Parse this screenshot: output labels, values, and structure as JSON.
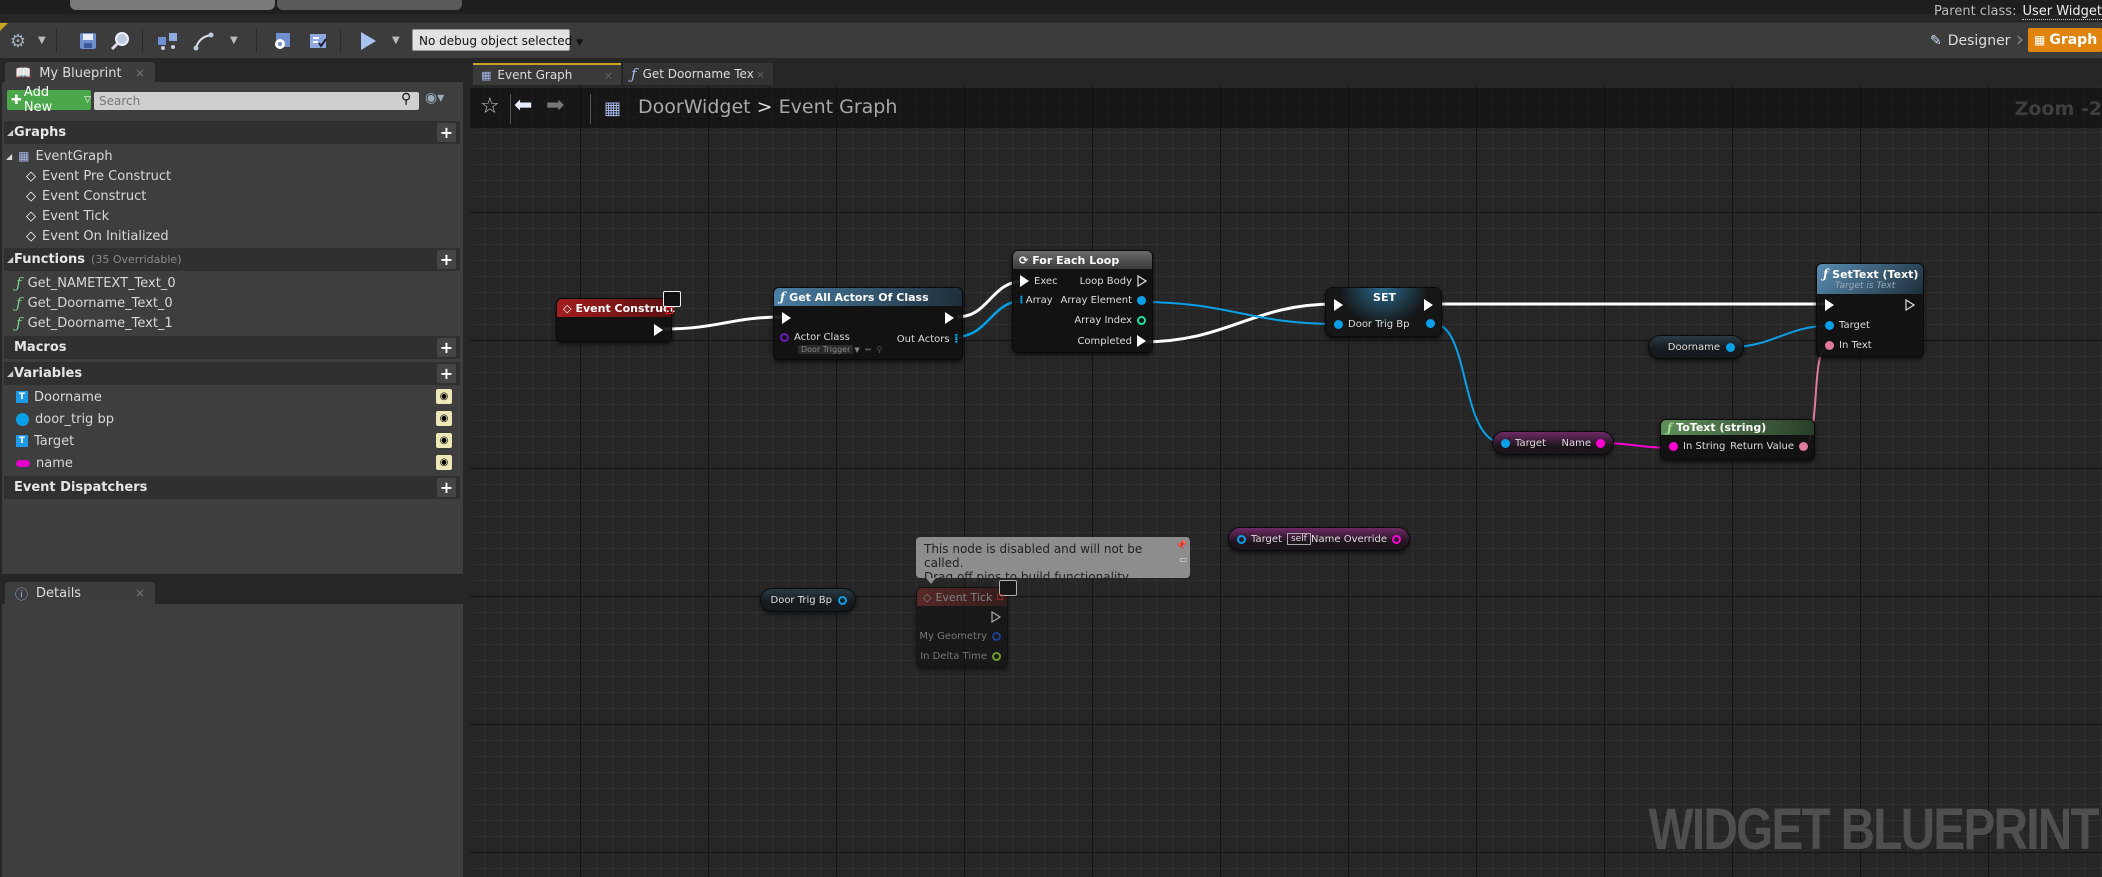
{
  "window": {
    "parent_class_label": "Parent class:",
    "parent_class_value": "User Widget"
  },
  "toolbar": {
    "compile_icon": "compile-gear-icon",
    "save_icon": "save-icon",
    "browse_icon": "find-in-browser-icon",
    "class_settings_icon": "class-settings-icon",
    "class_defaults_icon": "class-defaults-icon",
    "play_icon": "play-icon",
    "debug_object": "No debug object selected",
    "designer_label": "Designer",
    "graph_label": "Graph"
  },
  "my_blueprint": {
    "tab_label": "My Blueprint",
    "add_new_label": "Add New",
    "search_placeholder": "Search",
    "sections": {
      "graphs": {
        "label": "Graphs",
        "items": [
          {
            "label": "EventGraph"
          },
          {
            "label": "Event Pre Construct"
          },
          {
            "label": "Event Construct"
          },
          {
            "label": "Event Tick"
          },
          {
            "label": "Event On Initialized"
          }
        ]
      },
      "functions": {
        "label": "Functions",
        "hint": "(35 Overridable)",
        "items": [
          {
            "label": "Get_NAMETEXT_Text_0"
          },
          {
            "label": "Get_Doorname_Text_0"
          },
          {
            "label": "Get_Doorname_Text_1"
          }
        ]
      },
      "macros": {
        "label": "Macros"
      },
      "variables": {
        "label": "Variables",
        "items": [
          {
            "label": "Doorname",
            "type": "text-widget-ref",
            "color": "#1e9be8"
          },
          {
            "label": "door_trig bp",
            "type": "object-ref",
            "color": "#0aa0e8"
          },
          {
            "label": "Target",
            "type": "text-widget-ref",
            "color": "#1e9be8"
          },
          {
            "label": "name",
            "type": "string",
            "color": "#e000c8"
          }
        ]
      },
      "event_dispatchers": {
        "label": "Event Dispatchers"
      }
    }
  },
  "details": {
    "tab_label": "Details"
  },
  "graph_tabs": [
    {
      "label": "Event Graph",
      "active": true
    },
    {
      "label": "Get Doorname Tex",
      "active": false
    }
  ],
  "breadcrumb": {
    "root": "DoorWidget",
    "separator": ">",
    "current": "Event Graph"
  },
  "zoom_label": "Zoom -2",
  "watermark": "WIDGET BLUEPRINT",
  "nodes": {
    "event_construct": {
      "title": "Event Construct"
    },
    "get_all_actors": {
      "title": "Get All Actors Of Class",
      "actor_class_label": "Actor Class",
      "actor_class_value": "Door Trigger",
      "out_actors_label": "Out Actors"
    },
    "for_each_loop": {
      "title": "For Each Loop",
      "exec_label": "Exec",
      "array_label": "Array",
      "loop_body_label": "Loop Body",
      "array_element_label": "Array Element",
      "array_index_label": "Array Index",
      "completed_label": "Completed"
    },
    "set_node": {
      "title": "SET",
      "pin_label": "Door Trig Bp"
    },
    "set_text": {
      "title": "SetText (Text)",
      "subtitle": "Target is Text",
      "target_label": "Target",
      "in_text_label": "In Text"
    },
    "doorname_getter": {
      "label": "Doorname"
    },
    "name_getter": {
      "target_label": "Target",
      "name_label": "Name"
    },
    "to_text": {
      "title": "ToText (string)",
      "in_label": "In String",
      "out_label": "Return Value"
    },
    "name_override": {
      "target_label": "Target",
      "self_label": "self",
      "out_label": "Name Override"
    },
    "door_trig_getter": {
      "label": "Door Trig Bp"
    },
    "event_tick": {
      "title": "Event Tick",
      "geometry_label": "My Geometry",
      "delta_label": "In Delta Time",
      "comment": "This node is disabled and will not be called.\nDrag off pins to build functionality."
    }
  },
  "colors": {
    "accent_orange": "#e0840e",
    "add_new_green": "#4aa84a",
    "event_red": "#8e1a1a",
    "function_blue": "#3d6b8a",
    "pure_green": "#4d7a4d",
    "object_pin": "#0aa0e8",
    "string_pin": "#ff00d4",
    "text_pin": "#e07aa0",
    "int_pin": "#1fe0a0"
  }
}
